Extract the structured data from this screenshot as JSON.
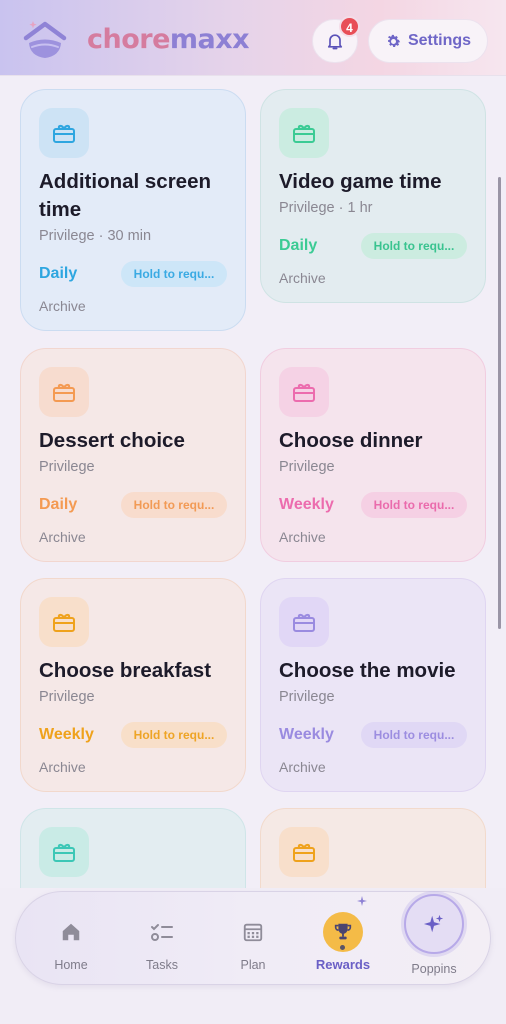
{
  "header": {
    "logo_part1": "chore",
    "logo_part2": "maxx",
    "notification_count": "4",
    "settings_label": "Settings"
  },
  "rewards": [
    {
      "title": "Additional screen time",
      "subtitle": "Privilege · 30 min",
      "frequency": "Daily",
      "hold_label": "Hold to requ...",
      "archive_label": "Archive",
      "theme": "blue"
    },
    {
      "title": "Video game time",
      "subtitle": "Privilege · 1 hr",
      "frequency": "Daily",
      "hold_label": "Hold to requ...",
      "archive_label": "Archive",
      "theme": "green"
    },
    {
      "title": "Dessert choice",
      "subtitle": "Privilege",
      "frequency": "Daily",
      "hold_label": "Hold to requ...",
      "archive_label": "Archive",
      "theme": "peach"
    },
    {
      "title": "Choose dinner",
      "subtitle": "Privilege",
      "frequency": "Weekly",
      "hold_label": "Hold to requ...",
      "archive_label": "Archive",
      "theme": "pink"
    },
    {
      "title": "Choose breakfast",
      "subtitle": "Privilege",
      "frequency": "Weekly",
      "hold_label": "Hold to requ...",
      "archive_label": "Archive",
      "theme": "orange"
    },
    {
      "title": "Choose the movie",
      "subtitle": "Privilege",
      "frequency": "Weekly",
      "hold_label": "Hold to requ...",
      "archive_label": "Archive",
      "theme": "purple"
    }
  ],
  "colors": {
    "blue": "#2ea6e0",
    "green": "#3bcb94",
    "peach": "#f49a52",
    "pink": "#ec6cae",
    "orange": "#efa21c",
    "purple": "#9a8be0",
    "teal": "#3cc7b6",
    "amber": "#efa21c",
    "nav_active": "#6a5fc6"
  },
  "nav": [
    {
      "label": "Home",
      "icon": "home-icon"
    },
    {
      "label": "Tasks",
      "icon": "tasks-icon"
    },
    {
      "label": "Plan",
      "icon": "calendar-icon"
    },
    {
      "label": "Rewards",
      "icon": "trophy-icon",
      "active": true
    },
    {
      "label": "Poppins",
      "icon": "sparkle-icon"
    }
  ]
}
